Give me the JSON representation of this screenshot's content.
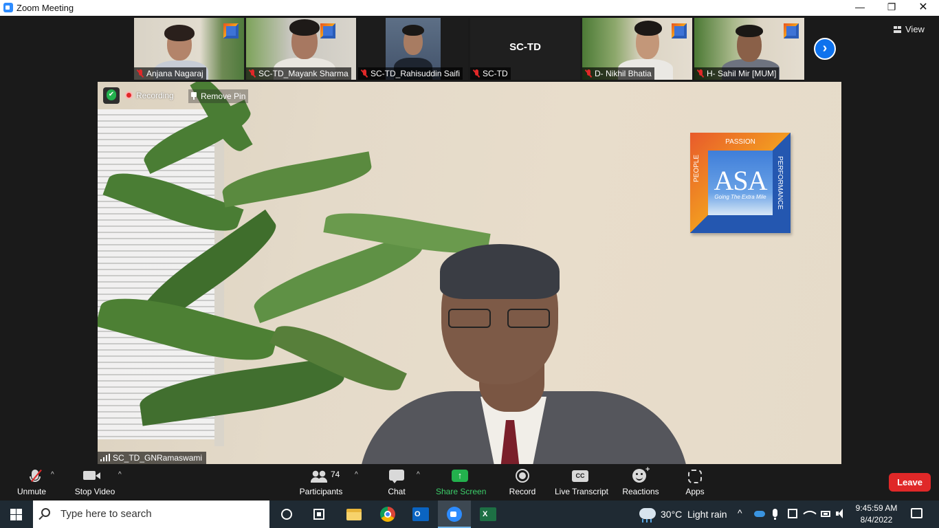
{
  "window": {
    "title": "Zoom Meeting",
    "minimize": "—",
    "maximize": "❐",
    "close": "✕"
  },
  "thumbnails": [
    {
      "name": "Anjana Nagaraj",
      "muted": true
    },
    {
      "name": "SC-TD_Mayank Sharma",
      "muted": true
    },
    {
      "name": "SC-TD_Rahisuddin Saifi",
      "muted": true
    },
    {
      "name": "SC-TD",
      "muted": true,
      "tile_text": "SC-TD"
    },
    {
      "name": "D- Nikhil Bhatia",
      "muted": true
    },
    {
      "name": "H- Sahil Mir [MUM]",
      "muted": true
    }
  ],
  "next_page": "›",
  "view_button": "View",
  "main_video": {
    "recording_label": "Recording",
    "remove_pin_label": "Remove Pin",
    "speaker_name": "SC_TD_GNRamaswami",
    "logo": {
      "text": "ASA",
      "tagline": "Going The Extra Mile",
      "top": "PASSION",
      "left": "PEOPLE",
      "right": "PERFORMANCE"
    }
  },
  "toolbar": {
    "unmute": "Unmute",
    "stop_video": "Stop Video",
    "participants": "Participants",
    "participants_count": "74",
    "chat": "Chat",
    "share_screen": "Share Screen",
    "record": "Record",
    "live_transcript": "Live Transcript",
    "cc_icon_text": "CC",
    "reactions": "Reactions",
    "apps": "Apps",
    "leave": "Leave",
    "caret": "^"
  },
  "taskbar": {
    "search_placeholder": "Type here to search",
    "weather_temp": "30°C",
    "weather_desc": "Light rain",
    "tray_up": "^",
    "time": "9:45:59 AM",
    "date": "8/4/2022",
    "outlook_letter": "O",
    "excel_letter": "X"
  },
  "colors": {
    "accent_blue": "#0e72ed",
    "share_green": "#23b14d",
    "leave_red": "#e02828",
    "toolbar_bg": "#1a1a1a",
    "taskbar_bg": "#1f2a33"
  }
}
